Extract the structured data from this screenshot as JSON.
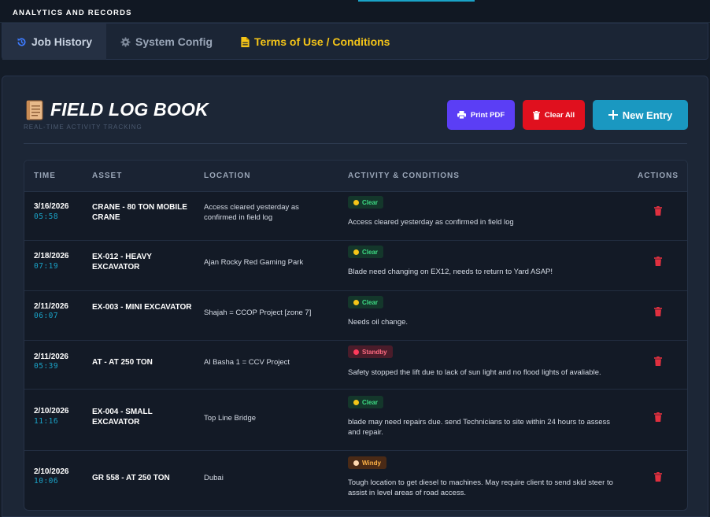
{
  "header": {
    "title": "ANALYTICS AND RECORDS"
  },
  "tabs": [
    {
      "label": "Job History",
      "icon": "history-icon"
    },
    {
      "label": "System Config",
      "icon": "gear-icon"
    },
    {
      "label": "Terms of Use / Conditions",
      "icon": "document-icon"
    }
  ],
  "page": {
    "title": "FIELD LOG BOOK",
    "subtitle": "REAL-TIME ACTIVITY TRACKING",
    "buttons": {
      "print": "Print PDF",
      "clear": "Clear All",
      "new_entry": "New Entry"
    }
  },
  "table": {
    "columns": [
      "TIME",
      "ASSET",
      "LOCATION",
      "ACTIVITY & CONDITIONS",
      "ACTIONS"
    ],
    "rows": [
      {
        "date": "3/16/2026",
        "time": "05:58",
        "asset": "CRANE - 80 TON MOBILE CRANE",
        "location": "Access cleared yesterday as confirmed in field log",
        "status": "Clear",
        "description": "Access cleared yesterday as confirmed in field log"
      },
      {
        "date": "2/18/2026",
        "time": "07:19",
        "asset": "EX-012 - HEAVY EXCAVATOR",
        "location": "Ajan Rocky Red Gaming Park",
        "status": "Clear",
        "description": "Blade need changing on EX12, needs to return to Yard ASAP!"
      },
      {
        "date": "2/11/2026",
        "time": "06:07",
        "asset": "EX-003 - MINI EXCAVATOR",
        "location": "Shajah = CCOP Project [zone 7]",
        "status": "Clear",
        "description": "Needs oil change."
      },
      {
        "date": "2/11/2026",
        "time": "05:39",
        "asset": "AT - AT 250 TON",
        "location": "Al Basha 1 = CCV Project",
        "status": "Standby",
        "description": "Safety stopped the lift due to lack of sun light and no flood lights of avaliable."
      },
      {
        "date": "2/10/2026",
        "time": "11:16",
        "asset": "EX-004 - SMALL EXCAVATOR",
        "location": "Top Line Bridge",
        "status": "Clear",
        "description": "blade may need repairs due. send Technicians to site within 24 hours to assess and repair."
      },
      {
        "date": "2/10/2026",
        "time": "10:06",
        "asset": "GR 558 - AT 250 TON",
        "location": "Dubai",
        "status": "Windy",
        "description": "Tough location to get diesel to machines. May require client to send skid steer to assist in level areas of road access."
      }
    ]
  },
  "colors": {
    "accent": "#1aa3c8",
    "print_button": "#5b3ef5",
    "clear_button": "#e0101e",
    "new_button": "#1a98c1",
    "status_clear": "#3ddc84",
    "status_standby": "#ff6b81",
    "status_windy": "#ffb347",
    "delete_icon": "#e0303f"
  }
}
